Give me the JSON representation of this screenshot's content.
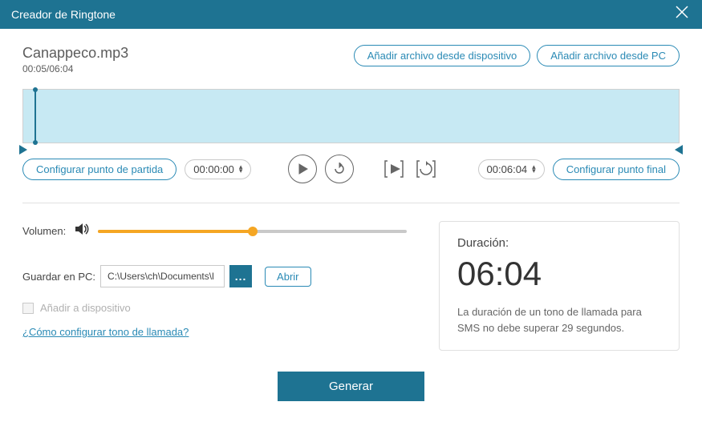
{
  "titlebar": {
    "title": "Creador de Ringtone"
  },
  "header": {
    "filename": "Canappeco.mp3",
    "timecode": "00:05/06:04",
    "add_from_device": "Añadir archivo desde dispositivo",
    "add_from_pc": "Añadir archivo desde PC"
  },
  "controls": {
    "set_start": "Configurar punto de partida",
    "start_time": "00:00:00",
    "end_time": "00:06:04",
    "set_end": "Configurar punto final"
  },
  "volume": {
    "label": "Volumen:"
  },
  "save": {
    "label": "Guardar en PC:",
    "path": "C:\\Users\\ch\\Documents\\l",
    "browse": "...",
    "open": "Abrir"
  },
  "add_device": {
    "label": "Añadir a dispositivo"
  },
  "help_link": "¿Cómo configurar tono de llamada?",
  "duration": {
    "label": "Duración:",
    "value": "06:04",
    "note": "La duración de un tono de llamada para SMS no debe superar 29 segundos."
  },
  "generate": "Generar"
}
